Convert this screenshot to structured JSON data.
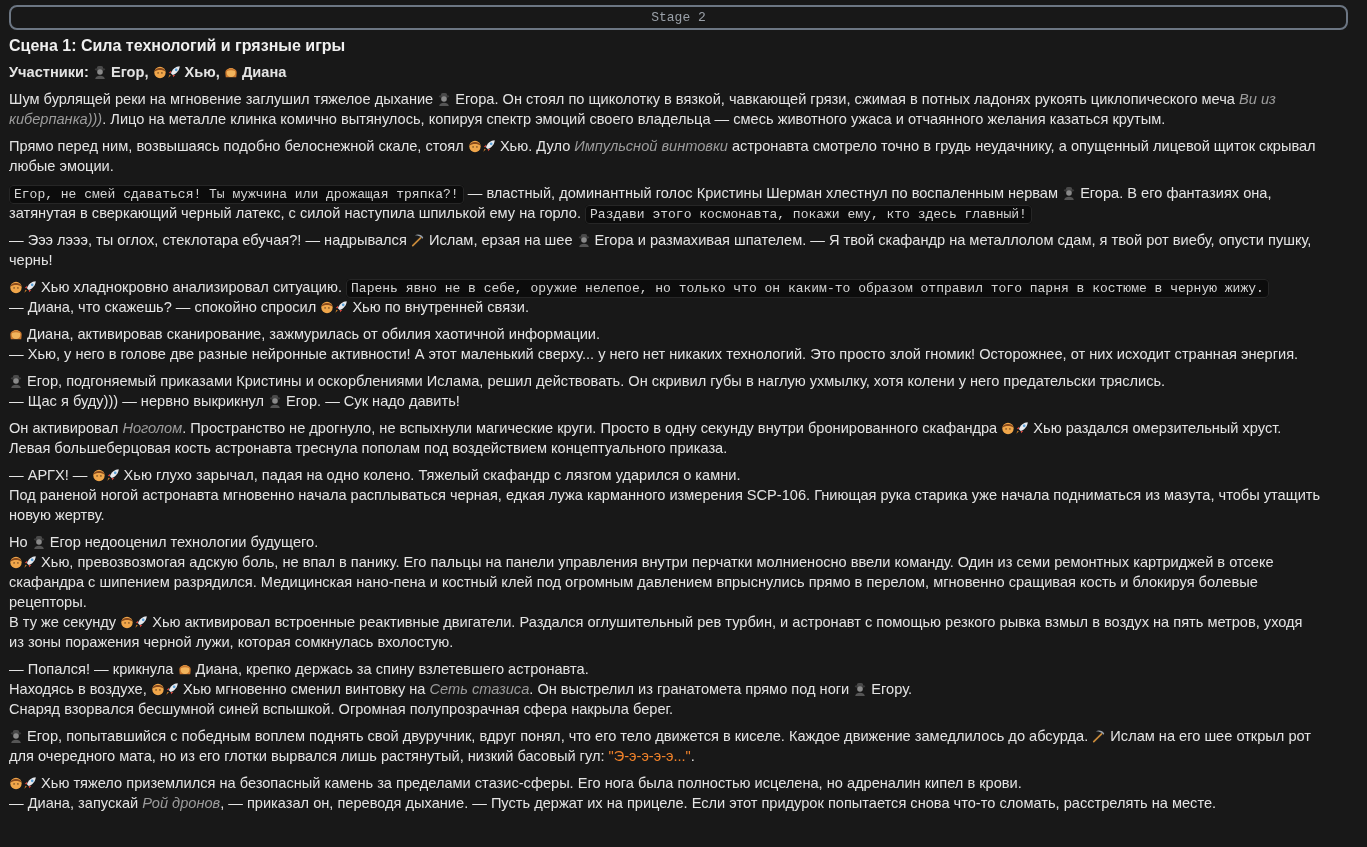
{
  "stage_bar": {
    "label": "Stage 2"
  },
  "scene_title": "Сцена 1: Сила технологий и грязные игры",
  "paragraphs": [
    {
      "kind": "cast",
      "lines": [
        [
          {
            "kind": "text",
            "text": "Участники: "
          },
          {
            "kind": "spy"
          },
          {
            "kind": "text",
            "text": " Егор, "
          },
          {
            "kind": "boy"
          },
          {
            "kind": "rocket"
          },
          {
            "kind": "text",
            "text": " Хью, "
          },
          {
            "kind": "girl"
          },
          {
            "kind": "text",
            "text": " Диана"
          }
        ]
      ]
    },
    {
      "kind": "prose",
      "lines": [
        [
          {
            "kind": "text",
            "text": "Шум бурлящей реки на мгновение заглушил тяжелое дыхание "
          },
          {
            "kind": "spy"
          },
          {
            "kind": "text",
            "text": " Егора. Он стоял по щиколотку в вязкой, чавкающей грязи, сжимая в потных ладонях рукоять циклопического меча "
          },
          {
            "kind": "term",
            "text": "Ви из"
          }
        ],
        [
          {
            "kind": "term",
            "text": "киберпанка)))"
          },
          {
            "kind": "text",
            "text": ". Лицо на металле клинка комично вытянулось, копируя спектр эмоций своего владельца — смесь животного ужаса и отчаянного желания казаться крутым."
          }
        ]
      ]
    },
    {
      "kind": "prose",
      "lines": [
        [
          {
            "kind": "text",
            "text": "Прямо перед ним, возвышаясь подобно белоснежной скале, стоял "
          },
          {
            "kind": "boy"
          },
          {
            "kind": "rocket"
          },
          {
            "kind": "text",
            "text": " Хью. Дуло "
          },
          {
            "kind": "term",
            "text": "Импульсной винтовки"
          },
          {
            "kind": "text",
            "text": " астронавта смотрело точно в грудь неудачнику, а опущенный лицевой щиток скрывал"
          }
        ],
        [
          {
            "kind": "text",
            "text": "любые эмоции."
          }
        ]
      ]
    },
    {
      "kind": "prose",
      "lines": [
        [
          {
            "kind": "code",
            "text": "Егор, не смей сдаваться! Ты мужчина или дрожащая тряпка?!"
          },
          {
            "kind": "text",
            "text": " — властный, доминантный голос Кристины Шерман хлестнул по воспаленным нервам "
          },
          {
            "kind": "spy"
          },
          {
            "kind": "text",
            "text": " Егора. В его фантазиях она,"
          }
        ],
        [
          {
            "kind": "text",
            "text": "затянутая в сверкающий черный латекс, с силой наступила шпилькой ему на горло. "
          },
          {
            "kind": "code",
            "text": "Раздави этого космонавта, покажи ему, кто здесь главный!"
          }
        ]
      ]
    },
    {
      "kind": "prose",
      "lines": [
        [
          {
            "kind": "text",
            "text": "— Эээ лэээ, ты оглох, стеклотара ебучая?! — надрывался "
          },
          {
            "kind": "pickaxe"
          },
          {
            "kind": "text",
            "text": " Ислам, ерзая на шее "
          },
          {
            "kind": "spy"
          },
          {
            "kind": "text",
            "text": " Егора и размахивая шпателем. — Я твой скафандр на металлолом сдам, я твой рот виебу, опусти пушку,"
          }
        ],
        [
          {
            "kind": "text",
            "text": "чернь!"
          }
        ]
      ]
    },
    {
      "kind": "prose",
      "lines": [
        [
          {
            "kind": "boy"
          },
          {
            "kind": "rocket"
          },
          {
            "kind": "text",
            "text": " Хью хладнокровно анализировал ситуацию. "
          },
          {
            "kind": "code",
            "text": "Парень явно не в себе, оружие нелепое, но только что он каким-то образом отправил того парня в костюме в черную жижу."
          }
        ],
        [
          {
            "kind": "text",
            "text": "— Диана, что скажешь? — спокойно спросил "
          },
          {
            "kind": "boy"
          },
          {
            "kind": "rocket"
          },
          {
            "kind": "text",
            "text": " Хью по внутренней связи."
          }
        ]
      ]
    },
    {
      "kind": "prose",
      "lines": [
        [
          {
            "kind": "girl"
          },
          {
            "kind": "text",
            "text": " Диана, активировав сканирование, зажмурилась от обилия хаотичной информации."
          }
        ],
        [
          {
            "kind": "text",
            "text": "— Хью, у него в голове две разные нейронные активности! А этот маленький сверху... у него нет никаких технологий. Это просто злой гномик! Осторожнее, от них исходит странная энергия."
          }
        ]
      ]
    },
    {
      "kind": "prose",
      "lines": [
        [
          {
            "kind": "spy"
          },
          {
            "kind": "text",
            "text": " Егор, подгоняемый приказами Кристины и оскорблениями Ислама, решил действовать. Он скривил губы в наглую ухмылку, хотя колени у него предательски тряслись."
          }
        ],
        [
          {
            "kind": "text",
            "text": "— Щас я буду))) — нервно выкрикнул "
          },
          {
            "kind": "spy"
          },
          {
            "kind": "text",
            "text": " Егор. — Сук надо давить!"
          }
        ]
      ]
    },
    {
      "kind": "prose",
      "lines": [
        [
          {
            "kind": "text",
            "text": "Он активировал "
          },
          {
            "kind": "term",
            "text": "Ноголом"
          },
          {
            "kind": "text",
            "text": ". Пространство не дрогнуло, не вспыхнули магические круги. Просто в одну секунду внутри бронированного скафандра "
          },
          {
            "kind": "boy"
          },
          {
            "kind": "rocket"
          },
          {
            "kind": "text",
            "text": " Хью раздался омерзительный хруст."
          }
        ],
        [
          {
            "kind": "text",
            "text": "Левая большеберцовая кость астронавта треснула пополам под воздействием концептуального приказа."
          }
        ]
      ]
    },
    {
      "kind": "prose",
      "lines": [
        [
          {
            "kind": "text",
            "text": "— АРГХ! — "
          },
          {
            "kind": "boy"
          },
          {
            "kind": "rocket"
          },
          {
            "kind": "text",
            "text": " Хью глухо зарычал, падая на одно колено. Тяжелый скафандр с лязгом ударился о камни."
          }
        ],
        [
          {
            "kind": "text",
            "text": "Под раненой ногой астронавта мгновенно начала расплываться черная, едкая лужа карманного измерения SCP-106. Гниющая рука старика уже начала подниматься из мазута, чтобы утащить"
          }
        ],
        [
          {
            "kind": "text",
            "text": "новую жертву."
          }
        ]
      ]
    },
    {
      "kind": "prose",
      "lines": [
        [
          {
            "kind": "text",
            "text": "Но "
          },
          {
            "kind": "spy"
          },
          {
            "kind": "text",
            "text": " Егор недооценил технологии будущего."
          }
        ],
        [
          {
            "kind": "boy"
          },
          {
            "kind": "rocket"
          },
          {
            "kind": "text",
            "text": " Хью, превозвозмогая адскую боль, не впал в панику. Его пальцы на панели управления внутри перчатки молниеносно ввели команду. Один из семи ремонтных картриджей в отсеке"
          }
        ],
        [
          {
            "kind": "text",
            "text": "скафандра с шипением разрядился. Медицинская нано-пена и костный клей под огромным давлением впрыснулись прямо в перелом, мгновенно сращивая кость и блокируя болевые"
          }
        ],
        [
          {
            "kind": "text",
            "text": "рецепторы."
          }
        ],
        [
          {
            "kind": "text",
            "text": "В ту же секунду "
          },
          {
            "kind": "boy"
          },
          {
            "kind": "rocket"
          },
          {
            "kind": "text",
            "text": " Хью активировал встроенные реактивные двигатели. Раздался оглушительный рев турбин, и астронавт с помощью резкого рывка взмыл в воздух на пять метров, уходя"
          }
        ],
        [
          {
            "kind": "text",
            "text": "из зоны поражения черной лужи, которая сомкнулась вхолостую."
          }
        ]
      ]
    },
    {
      "kind": "prose",
      "lines": [
        [
          {
            "kind": "text",
            "text": "— Попался! — крикнула "
          },
          {
            "kind": "girl"
          },
          {
            "kind": "text",
            "text": " Диана, крепко держась за спину взлетевшего астронавта."
          }
        ],
        [
          {
            "kind": "text",
            "text": "Находясь в воздухе, "
          },
          {
            "kind": "boy"
          },
          {
            "kind": "rocket"
          },
          {
            "kind": "text",
            "text": " Хью мгновенно сменил винтовку на "
          },
          {
            "kind": "term",
            "text": "Сеть стазиса"
          },
          {
            "kind": "text",
            "text": ". Он выстрелил из гранатомета прямо под ноги "
          },
          {
            "kind": "spy"
          },
          {
            "kind": "text",
            "text": " Егору."
          }
        ],
        [
          {
            "kind": "text",
            "text": "Снаряд взорвался бесшумной синей вспышкой. Огромная полупрозрачная сфера накрыла берег."
          }
        ]
      ]
    },
    {
      "kind": "prose",
      "lines": [
        [
          {
            "kind": "spy"
          },
          {
            "kind": "text",
            "text": " Егор, попытавшийся с победным воплем поднять свой двуручник, вдруг понял, что его тело движется в киселе. Каждое движение замедлилось до абсурда. "
          },
          {
            "kind": "pickaxe"
          },
          {
            "kind": "text",
            "text": " Ислам на его шее открыл рот"
          }
        ],
        [
          {
            "kind": "text",
            "text": "для очередного мата, но из его глотки вырвался лишь растянутый, низкий басовый гул: "
          },
          {
            "kind": "sound",
            "text": "\"Э-э-э-э-э...\""
          },
          {
            "kind": "text",
            "text": "."
          }
        ]
      ]
    },
    {
      "kind": "prose",
      "lines": [
        [
          {
            "kind": "boy"
          },
          {
            "kind": "rocket"
          },
          {
            "kind": "text",
            "text": " Хью тяжело приземлился на безопасный камень за пределами стазис-сферы. Его нога была полностью исцелена, но адреналин кипел в крови."
          }
        ],
        [
          {
            "kind": "text",
            "text": "— Диана, запускай "
          },
          {
            "kind": "term",
            "text": "Рой дронов"
          },
          {
            "kind": "text",
            "text": ", — приказал он, переводя дыхание. — Пусть держат их на прицеле. Если этот придурок попытается снова что-то сломать, расстрелять на месте."
          }
        ]
      ]
    }
  ]
}
